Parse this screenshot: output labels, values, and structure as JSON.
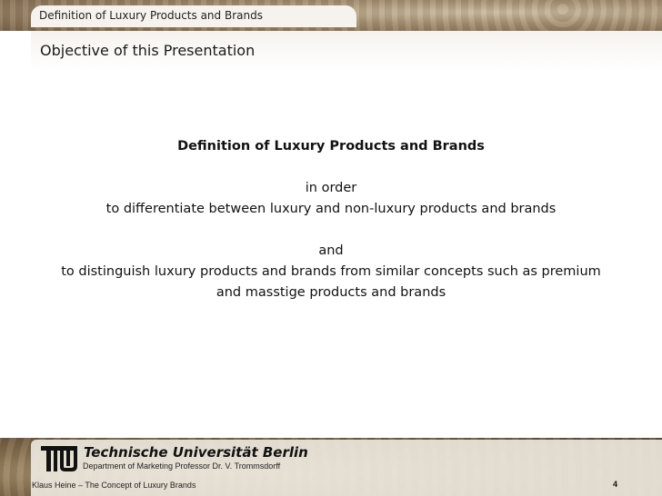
{
  "header": {
    "breadcrumb": "Definition of Luxury Products and Brands",
    "title": "Objective of this Presentation"
  },
  "content": {
    "heading": "Definition of Luxury Products and Brands",
    "line1": "in order",
    "line2": "to differentiate between luxury and non-luxury products and brands",
    "line3": "and",
    "line4": "to distinguish luxury products and brands from similar concepts such as premium",
    "line5": "and masstige products and brands"
  },
  "footer": {
    "university": "Technische Universität Berlin",
    "department": "Department of Marketing Professor Dr. V. Trommsdorff",
    "author": "Klaus Heine – The Concept of Luxury Brands",
    "page_number": "4",
    "logo_icon": "tu-berlin-logo-icon"
  }
}
